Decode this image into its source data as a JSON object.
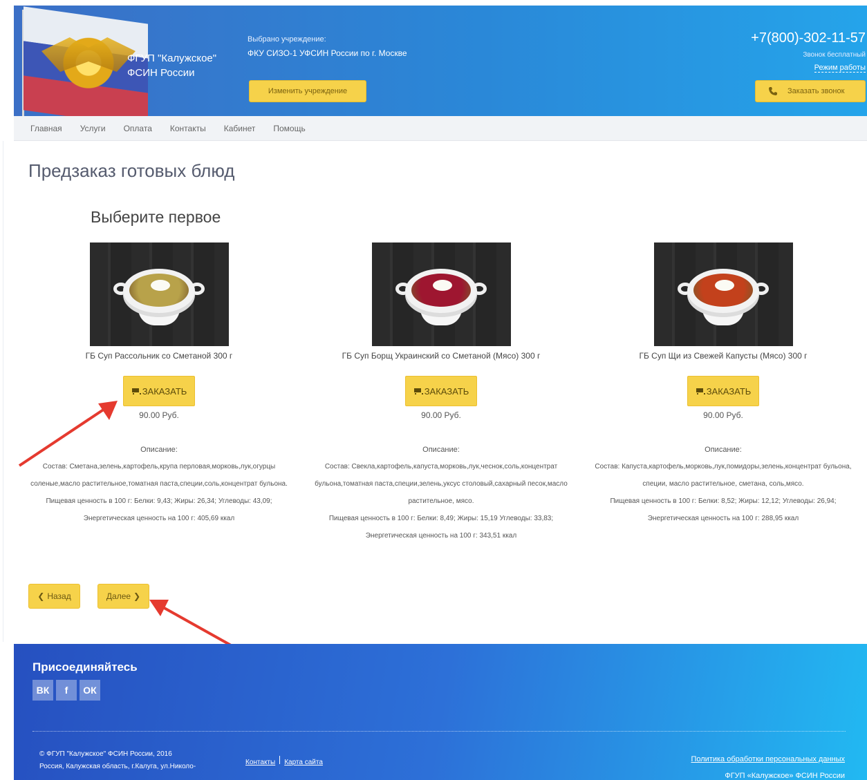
{
  "header": {
    "org_line1": "ФГУП \"Калужское\"",
    "org_line2": "ФСИН России",
    "institution_label": "Выбрано учреждение:",
    "institution_value": "ФКУ СИЗО-1 УФСИН России по г. Москве",
    "change_button": "Изменить учреждение",
    "phone": "+7(800)-302-11-57",
    "free_call": "Звонок бесплатный",
    "work_mode": "Режим работы",
    "callback_button": "Заказать звонок"
  },
  "nav": [
    "Главная",
    "Услуги",
    "Оплата",
    "Контакты",
    "Кабинет",
    "Помощь"
  ],
  "page_title": "Предзаказ готовых блюд",
  "section_title": "Выберите первое",
  "order_label": "ЗАКАЗАТЬ",
  "description_label": "Описание:",
  "dishes": [
    {
      "name": "ГБ Суп Рассольник со Сметаной 300 г",
      "price": "90.00 Руб.",
      "soup_color": "#b8a24a",
      "composition": "Состав: Сметана,зелень,картофель,крупа перловая,морковь,лук,огурцы соленые,масло растительное,томатная паста,специи,соль,концентрат бульона.",
      "nutrition": "Пищевая ценность в 100 г: Белки: 9,43; Жиры: 26,34; Углеводы: 43,09;",
      "energy": "Энергетическая ценность на 100 г: 405,69 ккал"
    },
    {
      "name": "ГБ Суп Борщ Украинский со Сметаной (Мясо) 300 г",
      "price": "90.00 Руб.",
      "soup_color": "#9e1630",
      "composition": "Состав: Свекла,картофель,капуста,морковь,лук,чеснок,соль,концентрат бульона,томатная паста,специи,зелень,уксус столовый,сахарный песок,масло растительное, мясо.",
      "nutrition": "Пищевая ценность в 100 г: Белки: 8,49; Жиры: 15,19 Углеводы: 33,83;",
      "energy": "Энергетическая ценность на 100 г: 343,51 ккал"
    },
    {
      "name": "ГБ Суп Щи из Свежей Капусты (Мясо) 300 г",
      "price": "90.00 Руб.",
      "soup_color": "#c3411c",
      "composition": "Состав: Капуста,картофель,морковь,лук,помидоры,зелень,концентрат бульона, специи, масло растительное, сметана, соль,мясо.",
      "nutrition": "Пищевая ценность в 100 г: Белки: 8,52; Жиры: 12,12; Углеводы: 26,94;",
      "energy": "Энергетическая ценность на 100 г: 288,95 ккал"
    }
  ],
  "pager": {
    "back": "Назад",
    "next": "Далее"
  },
  "footer": {
    "join": "Присоединяйтесь",
    "social": [
      "ВК",
      "f",
      "ОК"
    ],
    "copyright_line1": "© ФГУП \"Калужское\" ФСИН России, 2016",
    "copyright_line2": "Россия, Калужская область, г.Калуга, ул.Николо-",
    "links": [
      "Контакты",
      "Карта сайта"
    ],
    "policy": "Политика обработки персональных данных",
    "org": "ФГУП «Калужское» ФСИН России"
  },
  "colors": {
    "accent": "#f6d24a",
    "header_start": "#3b6fc6",
    "header_end": "#25a4ea",
    "arrow": "#e53a2f"
  }
}
